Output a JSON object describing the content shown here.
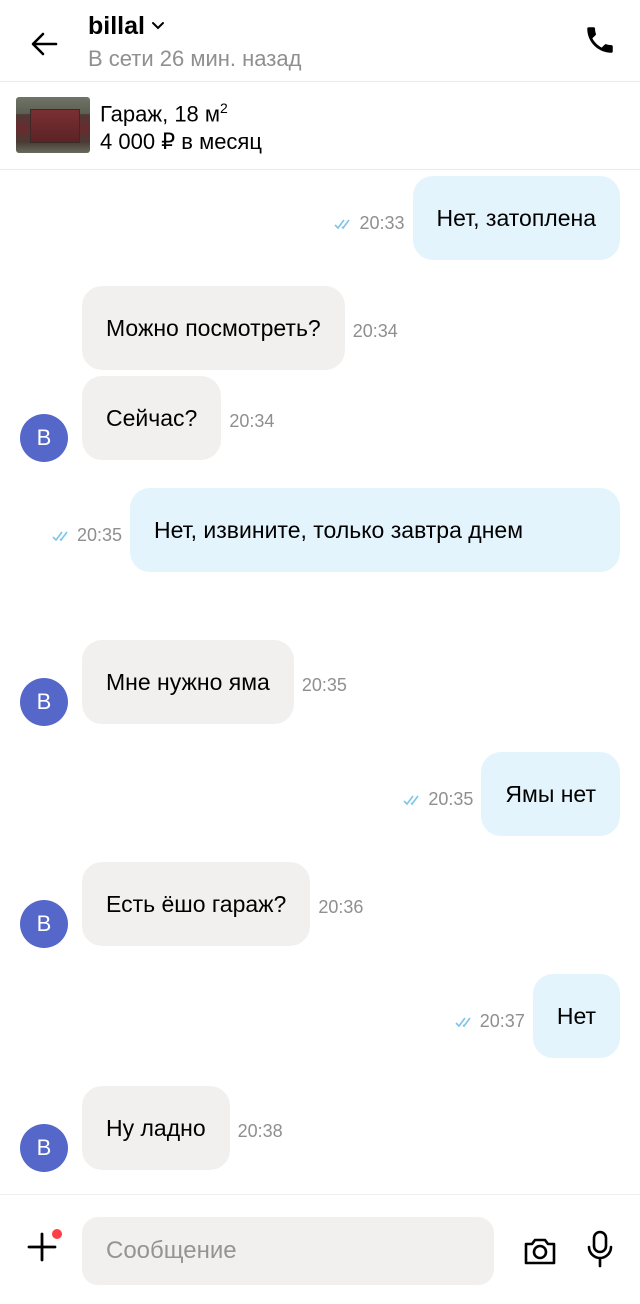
{
  "header": {
    "contact_name": "billal",
    "status": "В сети 26 мин. назад"
  },
  "listing": {
    "title": "Гараж, 18 м",
    "title_sup": "2",
    "price": "4 000 ₽ в месяц"
  },
  "avatar_letter": "B",
  "messages": [
    {
      "dir": "out",
      "text": "Нет, затоплена",
      "time": "20:33",
      "read": true
    },
    {
      "dir": "in",
      "text": "Можно посмотреть?",
      "time": "20:34"
    },
    {
      "dir": "in",
      "text": "Сейчас?",
      "time": "20:34"
    },
    {
      "dir": "out",
      "text": "Нет, извините,  только завтра днем",
      "time": "20:35",
      "read": true
    },
    {
      "dir": "in",
      "text": "Мне нужно яма",
      "time": "20:35"
    },
    {
      "dir": "out",
      "text": "Ямы нет",
      "time": "20:35",
      "read": true
    },
    {
      "dir": "in",
      "text": "Есть ёшо гараж?",
      "time": "20:36"
    },
    {
      "dir": "out",
      "text": "Нет",
      "time": "20:37",
      "read": true
    },
    {
      "dir": "in",
      "text": "Ну ладно",
      "time": "20:38"
    }
  ],
  "composer": {
    "placeholder": "Сообщение"
  },
  "icons": {
    "back": "arrow-left-icon",
    "dropdown": "chevron-down-icon",
    "call": "phone-icon",
    "read_status": "double-check-icon",
    "attach": "plus-icon",
    "camera": "camera-icon",
    "voice": "microphone-icon"
  },
  "colors": {
    "outgoing_bubble": "#e3f4fd",
    "incoming_bubble": "#f1f0ef",
    "avatar": "#5567c9",
    "check": "#7ec4e8",
    "notification_dot": "#ff3f45"
  }
}
